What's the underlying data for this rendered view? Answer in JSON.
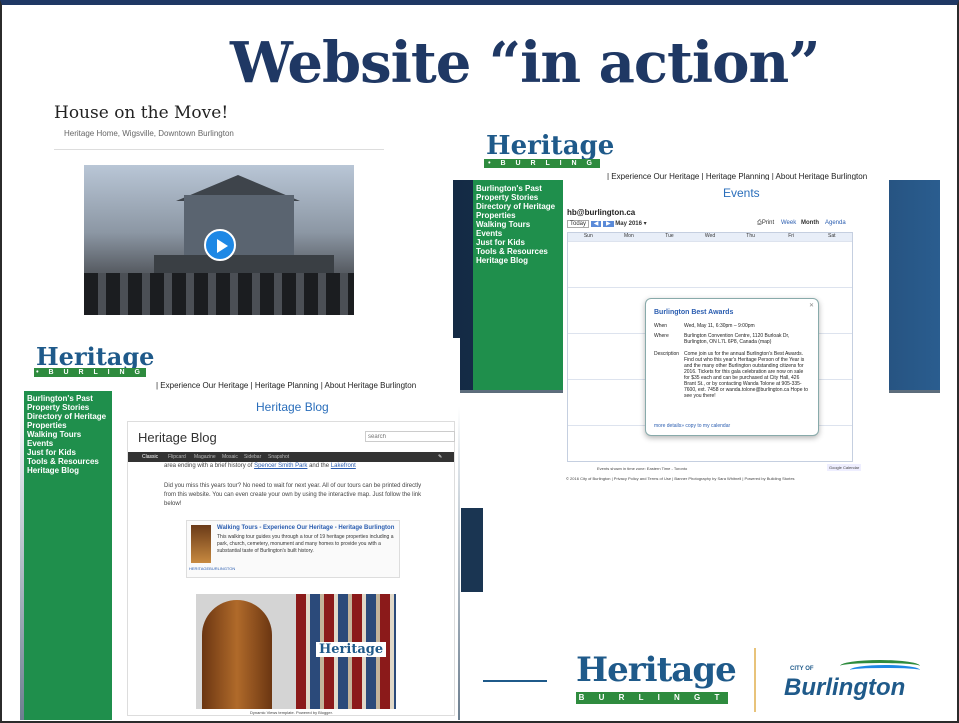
{
  "slide": {
    "title": "Website “in action”"
  },
  "house_panel": {
    "title": "House on the Move!",
    "subtitle": "Heritage Home, Wigsville, Downtown Burlington"
  },
  "heritage_logo": {
    "word": "Heritage",
    "band": "• B U R L I N G T O N •"
  },
  "site": {
    "nav": "| Experience Our Heritage | Heritage Planning | About Heritage Burlington",
    "sidebar": [
      "Burlington's Past",
      "Property Stories",
      "Directory of Heritage Properties",
      "Walking Tours",
      "Events",
      "Just for Kids",
      "Tools & Resources",
      "Heritage Blog"
    ]
  },
  "events": {
    "title": "Events",
    "email": "hb@burlington.ca",
    "toolbar": {
      "today": "Today",
      "month_label": "May 2016",
      "print": "Print",
      "week": "Week",
      "month": "Month",
      "agenda": "Agenda"
    },
    "weekdays": [
      "Sun",
      "Mon",
      "Tue",
      "Wed",
      "Thu",
      "Fri",
      "Sat"
    ],
    "popup": {
      "title": "Burlington Best Awards",
      "when_label": "When",
      "when": "Wed, May 11, 6:30pm – 9:00pm",
      "where_label": "Where",
      "where": "Burlington Convention Centre, 1120 Burloak Dr, Burlington, ON L7L 6P8, Canada (map)",
      "desc_label": "Description",
      "desc": "Come join us for the annual Burlington's Best Awards. Find out who this year's Heritage Person of the Year is and the many other Burlington outstanding citizens for 2016. Tickets for this gala celebration are now on sale for $35 each and can be purchased at City Hall, 426 Brant St., or by contacting Wanda Tolone at 905-335-7600, ext. 7458 or wanda.tolone@burlington.ca Hope to see you there!",
      "links": "more details»   copy to my calendar"
    },
    "timezone": "Events shown in time zone: Eastern Time - Toronto",
    "google_calendar": "Google Calendar",
    "footer": "© 2016 City of Burlington | Privacy Policy and Terms of Use | Banner Photography by Sara Whitnell | Powered by Building Stories"
  },
  "blog": {
    "page_title": "Heritage Blog",
    "header": "Heritage Blog",
    "search_placeholder": "search",
    "tabs": [
      "Classic",
      "Flipcard",
      "Magazine",
      "Mosaic",
      "Sidebar",
      "Snapshot"
    ],
    "line1_prefix": "area ending with a brief history of ",
    "link1": "Spencer Smith Park",
    "line1_mid": " and the ",
    "link2": "Lakefront",
    "para2": "Did you miss this years tour? No need to wait for next year. All of our tours can be printed directly from this website. You can even create your own by using the interactive map. Just follow the link below!",
    "embed_title": "Walking Tours - Experience Our Heritage - Heritage Burlington",
    "embed_desc": "This walking tour guides you through a tour of 19 heritage properties including a park, church, cemetery, monument and many homes to provide you with a substantial taste of Burlington's built history.",
    "embed_source": "HERITAGEBURLINGTON",
    "mosaic_logo": "Heritage",
    "footer": "Dynamic Views template. Powered by Blogger."
  },
  "bottom_logos": {
    "heritage_word": "Heritage",
    "heritage_band": "B U R L I N G T O N",
    "city_of": "CITY OF",
    "burlington": "Burlington"
  },
  "colors": {
    "title_navy": "#1f3864",
    "heritage_blue": "#1f5a8a",
    "heritage_green": "#2e8b3e",
    "sidebar_green": "#1f8f4c",
    "link_blue": "#2a5db0"
  }
}
